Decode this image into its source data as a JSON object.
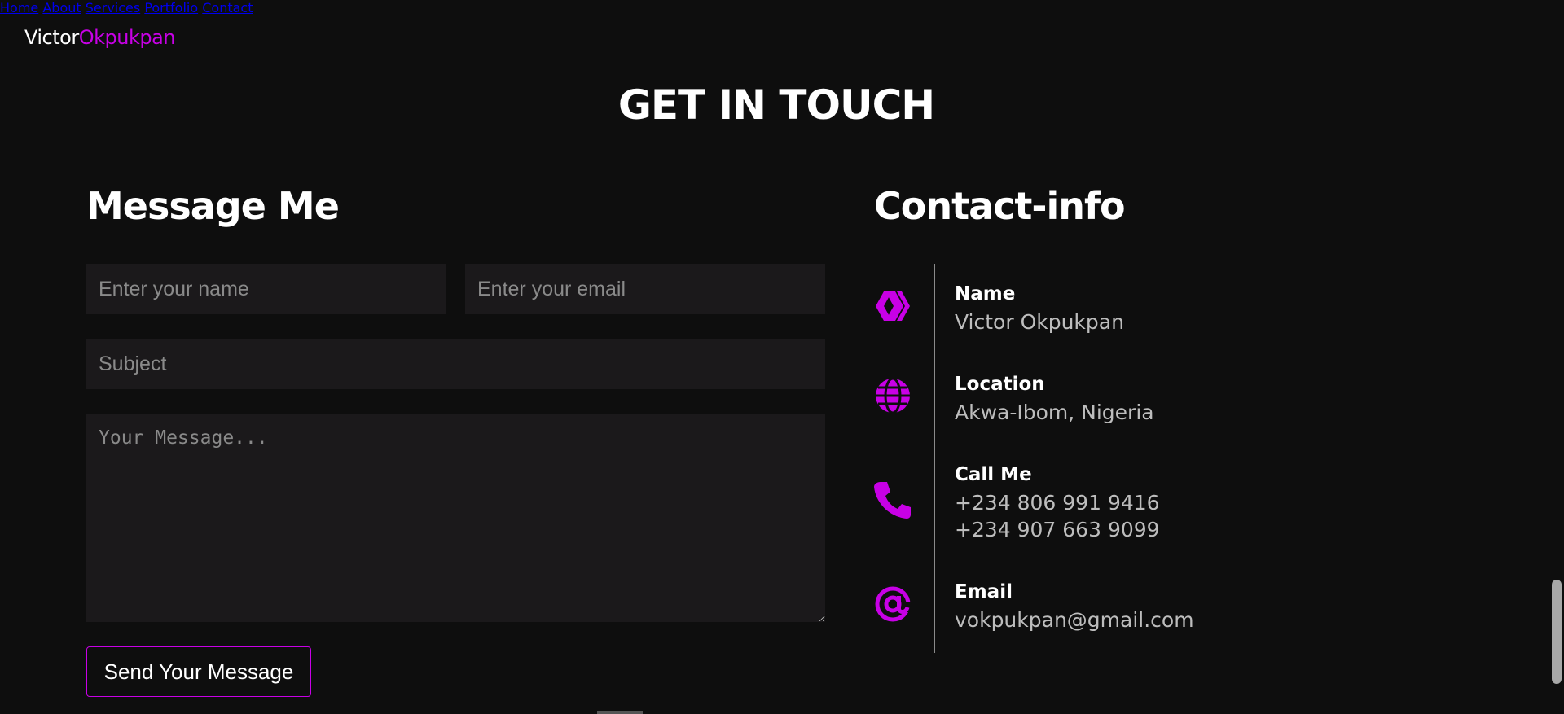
{
  "brand": {
    "first": "Victor",
    "last": "Okpukpan",
    "accent_color": "#c800e6"
  },
  "nav": {
    "items": [
      "Home",
      "About",
      "Services",
      "Portfolio",
      "Contact"
    ]
  },
  "section_title": "GET IN TOUCH",
  "form": {
    "heading": "Message Me",
    "name_placeholder": "Enter your name",
    "email_placeholder": "Enter your email",
    "subject_placeholder": "Subject",
    "message_placeholder": "Your Message...",
    "submit_label": "Send Your Message"
  },
  "contact_info": {
    "heading": "Contact-info",
    "items": [
      {
        "icon": "hive-icon",
        "label": "Name",
        "values": [
          "Victor Okpukpan"
        ]
      },
      {
        "icon": "globe-icon",
        "label": "Location",
        "values": [
          "Akwa-Ibom, Nigeria"
        ]
      },
      {
        "icon": "phone-icon",
        "label": "Call Me",
        "values": [
          "+234 806 991 9416",
          "+234 907 663 9099"
        ]
      },
      {
        "icon": "at-sign-icon",
        "label": "Email",
        "values": [
          "vokpukpan@gmail.com"
        ]
      }
    ]
  }
}
